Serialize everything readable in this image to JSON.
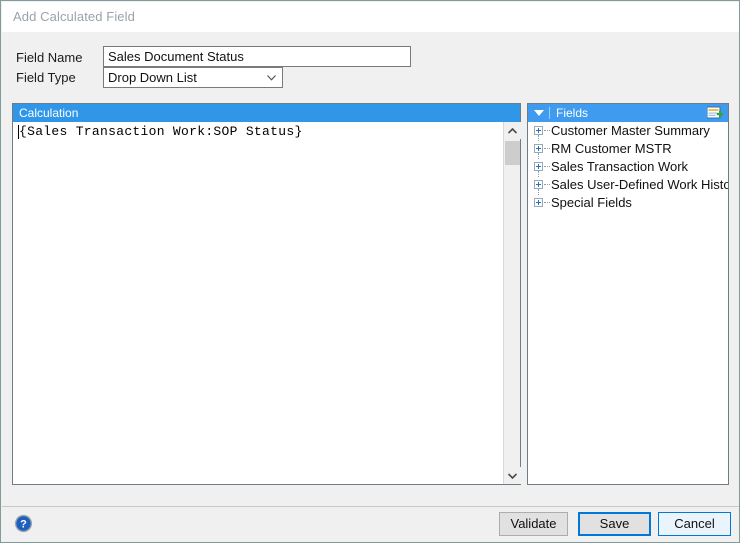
{
  "window": {
    "title": "Add Calculated Field",
    "border_color": "#7f9c9c",
    "body_color": "#f0f0f0"
  },
  "form": {
    "field_name": {
      "label": "Field Name",
      "value": "Sales Document Status",
      "placeholder": ""
    },
    "field_type": {
      "label": "Field Type",
      "value": "Drop Down List",
      "options": [
        "Drop Down List"
      ],
      "arrow_icon": "chevron-down-icon"
    }
  },
  "calculation_panel": {
    "header_title": "Calculation",
    "header_color": "#2f96e8",
    "expression": "{Sales Transaction Work:SOP Status}",
    "scrollbar": {
      "up_icon": "chevron-up-icon",
      "down_icon": "chevron-down-icon"
    }
  },
  "fields_panel": {
    "header_title": "Fields",
    "header_color": "#3f9bf0",
    "caret_icon": "triangle-down-icon",
    "add_icon": "add-field-icon",
    "items": [
      {
        "label": "Customer Master Summary",
        "expand_icon": "plus-box-icon"
      },
      {
        "label": "RM Customer MSTR",
        "expand_icon": "plus-box-icon"
      },
      {
        "label": "Sales Transaction Work",
        "expand_icon": "plus-box-icon"
      },
      {
        "label": "Sales User-Defined Work History",
        "expand_icon": "plus-box-icon"
      },
      {
        "label": "Special Fields",
        "expand_icon": "plus-box-icon"
      }
    ]
  },
  "footer": {
    "help_icon": "help-question-icon",
    "buttons": {
      "validate": "Validate",
      "save": "Save",
      "cancel": "Cancel"
    },
    "accent_color": "#0078d7"
  }
}
